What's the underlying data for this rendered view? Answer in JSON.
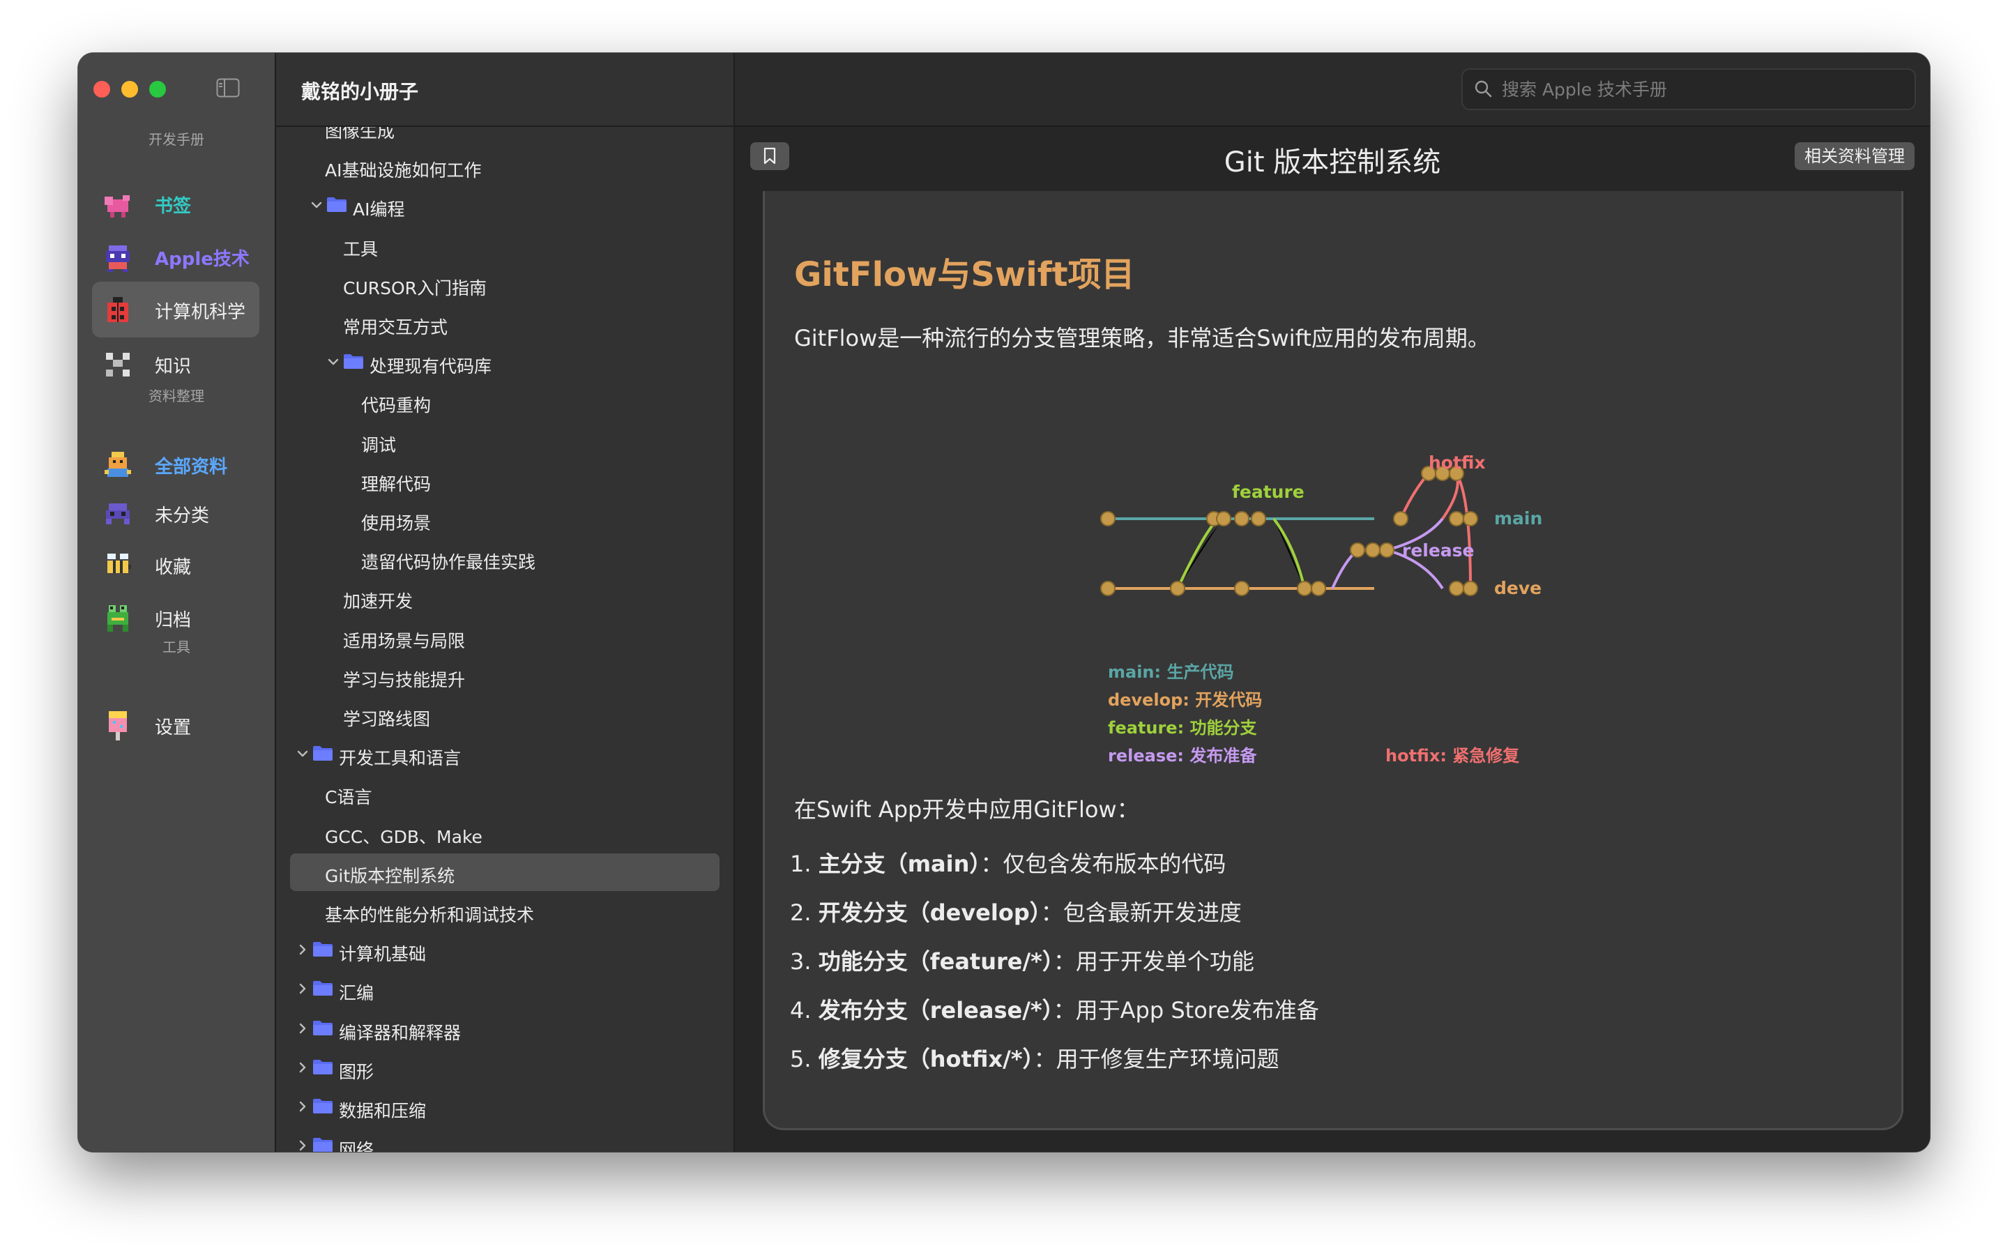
{
  "sidebar": {
    "sections": [
      "开发手册",
      "资料整理",
      "工具"
    ],
    "items": [
      {
        "label": "书签",
        "color": "#34c9c3",
        "icon": "bookmark-icon"
      },
      {
        "label": "Apple技术",
        "color": "#8c78ff",
        "icon": "apple-tech-icon"
      },
      {
        "label": "计算机科学",
        "color": "#f0f0f0",
        "icon": "ladybug-icon"
      },
      {
        "label": "知识",
        "color": "#f0f0f0",
        "icon": "knowledge-icon"
      },
      {
        "label": "全部资料",
        "color": "#5aa8ff",
        "icon": "all-materials-icon"
      },
      {
        "label": "未分类",
        "color": "#f0f0f0",
        "icon": "uncategorized-icon"
      },
      {
        "label": "收藏",
        "color": "#f0f0f0",
        "icon": "bee-icon"
      },
      {
        "label": "归档",
        "color": "#f0f0f0",
        "icon": "frog-icon"
      },
      {
        "label": "设置",
        "color": "#f0f0f0",
        "icon": "popsicle-icon"
      }
    ]
  },
  "nav": {
    "title": "戴铭的小册子",
    "tree": [
      {
        "label": "图像生成",
        "indent": 2
      },
      {
        "label": "AI基础设施如何工作",
        "indent": 2
      },
      {
        "label": "AI编程",
        "indent": 1,
        "folder": true,
        "expanded": true
      },
      {
        "label": "工具",
        "indent": 3
      },
      {
        "label": "CURSOR入门指南",
        "indent": 3
      },
      {
        "label": "常用交互方式",
        "indent": 3
      },
      {
        "label": "处理现有代码库",
        "indent": 2,
        "folder": true,
        "expanded": true
      },
      {
        "label": "代码重构",
        "indent": 4
      },
      {
        "label": "调试",
        "indent": 4
      },
      {
        "label": "理解代码",
        "indent": 4
      },
      {
        "label": "使用场景",
        "indent": 4
      },
      {
        "label": "遗留代码协作最佳实践",
        "indent": 4
      },
      {
        "label": "加速开发",
        "indent": 3
      },
      {
        "label": "适用场景与局限",
        "indent": 3
      },
      {
        "label": "学习与技能提升",
        "indent": 3
      },
      {
        "label": "学习路线图",
        "indent": 3
      },
      {
        "label": "开发工具和语言",
        "indent": 0,
        "folder": true,
        "expanded": true
      },
      {
        "label": "C语言",
        "indent": 2
      },
      {
        "label": "GCC、GDB、Make",
        "indent": 2
      },
      {
        "label": "Git版本控制系统",
        "indent": 2,
        "selected": true
      },
      {
        "label": "基本的性能分析和调试技术",
        "indent": 2
      },
      {
        "label": "计算机基础",
        "indent": 0,
        "folder": true,
        "expanded": false
      },
      {
        "label": "汇编",
        "indent": 0,
        "folder": true,
        "expanded": false
      },
      {
        "label": "编译器和解释器",
        "indent": 0,
        "folder": true,
        "expanded": false
      },
      {
        "label": "图形",
        "indent": 0,
        "folder": true,
        "expanded": false
      },
      {
        "label": "数据和压缩",
        "indent": 0,
        "folder": true,
        "expanded": false
      },
      {
        "label": "网络",
        "indent": 0,
        "folder": true,
        "expanded": false
      }
    ]
  },
  "search": {
    "placeholder": "搜索 Apple 技术手册"
  },
  "doc": {
    "title": "Git 版本控制系统",
    "manage_label": "相关资料管理",
    "heading": "GitFlow与Swift项目",
    "intro": "GitFlow是一种流行的分支管理策略，非常适合Swift应用的发布周期。",
    "diagram": {
      "branch_labels": {
        "main": "main",
        "develop": "deve",
        "feature": "feature",
        "release": "release",
        "hotfix": "hotfix"
      },
      "legend": [
        {
          "text": "main: 生产代码",
          "color": "#5ba6a6"
        },
        {
          "text": "develop: 开发代码",
          "color": "#e2a35e"
        },
        {
          "text": "feature: 功能分支",
          "color": "#9fd13c"
        },
        {
          "text": "release: 发布准备",
          "color": "#c59af0"
        },
        {
          "text": "hotfix: 紧急修复",
          "color": "#f07070"
        }
      ]
    },
    "para2": "在Swift App开发中应用GitFlow：",
    "list": [
      {
        "num": "1.",
        "bold": "主分支（main）",
        "rest": "：仅包含发布版本的代码"
      },
      {
        "num": "2.",
        "bold": "开发分支（develop）",
        "rest": "：包含最新开发进度"
      },
      {
        "num": "3.",
        "bold": "功能分支（feature/*）",
        "rest": "：用于开发单个功能"
      },
      {
        "num": "4.",
        "bold": "发布分支（release/*）",
        "rest": "：用于App Store发布准备"
      },
      {
        "num": "5.",
        "bold": "修复分支（hotfix/*）",
        "rest": "：用于修复生产环境问题"
      }
    ]
  }
}
